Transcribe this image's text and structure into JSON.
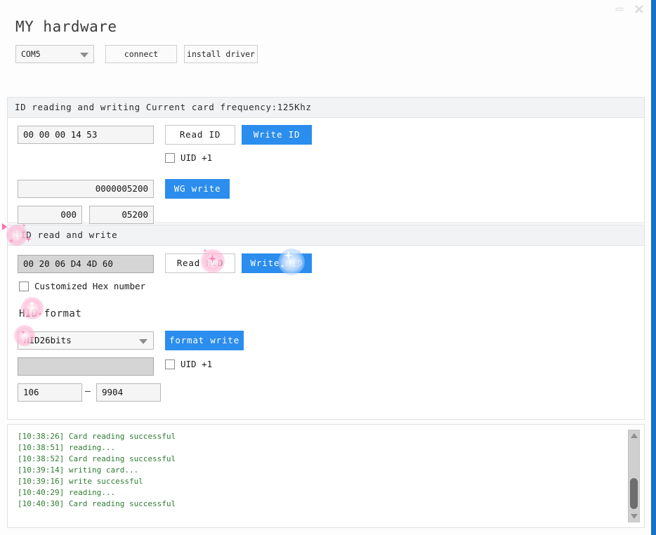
{
  "window": {
    "minimize_icon": "minimize-icon",
    "close_icon": "close-icon",
    "accent_color": "#1673c9"
  },
  "header": {
    "title": "MY hardware",
    "port_select": {
      "value": "COM5",
      "caret_icon": "chevron-down-icon"
    },
    "connect_label": "connect",
    "install_driver_label": "install driver"
  },
  "id_section": {
    "header": "ID reading and writing  Current card frequency:125Khz",
    "id_value": "00 00 00 14 53",
    "read_id_label": "Read ID",
    "write_id_label": "Write ID",
    "uid_plus_label": "UID +1",
    "wg_value": "0000005200",
    "wg_write_label": "WG write",
    "wg_part1": "000",
    "wg_part2": "05200"
  },
  "hid_section": {
    "header": "HID read and write",
    "hid_value": "00 20 06 D4 4D 60",
    "read_hid_label": "Read HID",
    "write_hid_label": "Write HID",
    "custom_hex_label": "Customized Hex number",
    "format_label": "HID format",
    "format_select_value": "HID26bits",
    "format_caret_icon": "chevron-down-icon",
    "format_write_label": "format write",
    "format_result_value": "",
    "uid_plus_label": "UID +1",
    "range_start": "106",
    "range_dash": "—",
    "range_end": "9904"
  },
  "log": {
    "lines": [
      "[10:38:26] Card reading successful",
      "[10:38:51] reading...",
      "[10:38:52] Card reading successful",
      "[10:39:14] writing card...",
      "[10:39:16] write successful",
      "[10:40:29] reading...",
      "[10:40:30] Card reading successful"
    ],
    "text_color": "#2e7d32",
    "scrollbar": {
      "up_icon": "scroll-up-arrow-icon",
      "down_icon": "scroll-down-arrow-icon"
    }
  }
}
